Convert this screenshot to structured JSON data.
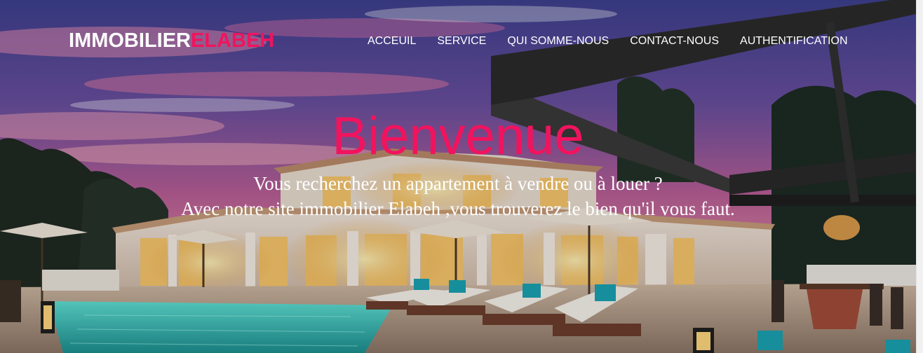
{
  "brand": {
    "part1": "IMMOBILIER",
    "part2": "ELABEH"
  },
  "nav": {
    "items": [
      {
        "label": "ACCEUIL"
      },
      {
        "label": "SERVICE"
      },
      {
        "label": "QUI SOMME-NOUS"
      },
      {
        "label": "CONTACT-NOUS"
      },
      {
        "label": "AUTHENTIFICATION"
      }
    ]
  },
  "hero": {
    "title": "Bienvenue",
    "line1": "Vous recherchez un appartement à vendre ou à louer ?",
    "line2": "Avec notre site immobilier Elabeh ,vous trouverez le bien qu'il vous faut."
  },
  "colors": {
    "accent": "#f2135e",
    "text": "#ffffff"
  }
}
